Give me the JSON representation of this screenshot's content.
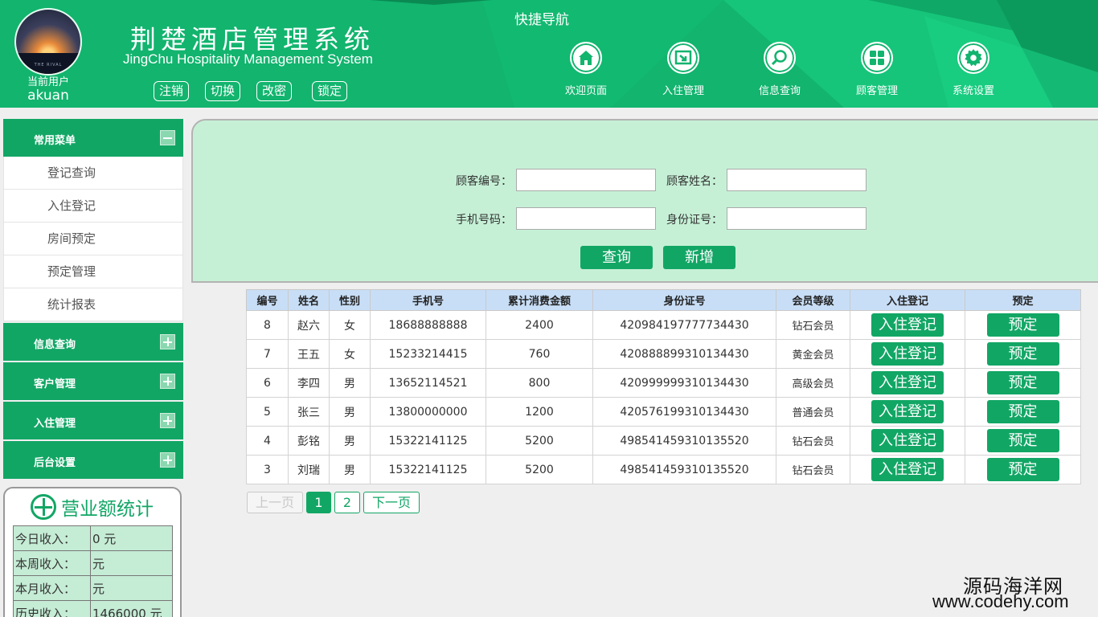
{
  "header": {
    "current_user_label": "当前用户",
    "username": "akuan",
    "avatar_caption": "THE RIVAL",
    "title_cn": "荆楚酒店管理系统",
    "title_en": "JingChu Hospitality Management System",
    "buttons": [
      "注销",
      "切换",
      "改密",
      "锁定"
    ],
    "quick_nav_title": "快捷导航",
    "nav": [
      {
        "label": "欢迎页面",
        "icon": "home-icon"
      },
      {
        "label": "入住管理",
        "icon": "checkin-icon"
      },
      {
        "label": "信息查询",
        "icon": "search-icon"
      },
      {
        "label": "顾客管理",
        "icon": "grid-icon"
      },
      {
        "label": "系统设置",
        "icon": "gear-icon"
      }
    ],
    "colors": {
      "primary": "#12b46e",
      "dark": "#0c9a5c"
    }
  },
  "sidebar": {
    "common_menu": {
      "title": "常用菜单",
      "items": [
        "登记查询",
        "入住登记",
        "房间预定",
        "预定管理",
        "统计报表"
      ]
    },
    "groups": [
      "信息查询",
      "客户管理",
      "入住管理",
      "后台设置"
    ]
  },
  "revenue": {
    "title": "营业额统计",
    "rows": [
      {
        "label": "今日收入：",
        "value": "0 元"
      },
      {
        "label": "本周收入：",
        "value": "元"
      },
      {
        "label": "本月收入：",
        "value": "元"
      },
      {
        "label": "历史收入：",
        "value": "1466000 元"
      }
    ]
  },
  "search": {
    "customer_id_label": "顾客编号：",
    "customer_name_label": "顾客姓名：",
    "phone_label": "手机号码：",
    "id_card_label": "身份证号：",
    "customer_id_value": "",
    "customer_name_value": "",
    "phone_value": "",
    "id_card_value": "",
    "query_button": "查询",
    "add_button": "新增"
  },
  "table": {
    "headers": [
      "编号",
      "姓名",
      "性别",
      "手机号",
      "累计消费金额",
      "身份证号",
      "会员等级",
      "入住登记",
      "预定"
    ],
    "checkin_button": "入住登记",
    "reserve_button": "预定",
    "rows": [
      {
        "id": "8",
        "name": "赵六",
        "gender": "女",
        "phone": "18688888888",
        "spend": "2400",
        "idcard": "420984197777734430",
        "level": "钻石会员"
      },
      {
        "id": "7",
        "name": "王五",
        "gender": "女",
        "phone": "15233214415",
        "spend": "760",
        "idcard": "420888899310134430",
        "level": "黄金会员"
      },
      {
        "id": "6",
        "name": "李四",
        "gender": "男",
        "phone": "13652114521",
        "spend": "800",
        "idcard": "420999999310134430",
        "level": "高级会员"
      },
      {
        "id": "5",
        "name": "张三",
        "gender": "男",
        "phone": "13800000000",
        "spend": "1200",
        "idcard": "420576199310134430",
        "level": "普通会员"
      },
      {
        "id": "4",
        "name": "彭铭",
        "gender": "男",
        "phone": "15322141125",
        "spend": "5200",
        "idcard": "498541459310135520",
        "level": "钻石会员"
      },
      {
        "id": "3",
        "name": "刘瑞",
        "gender": "男",
        "phone": "15322141125",
        "spend": "5200",
        "idcard": "498541459310135520",
        "level": "钻石会员"
      }
    ]
  },
  "pagination": {
    "prev": "上一页",
    "pages": [
      "1",
      "2"
    ],
    "current": "1",
    "next": "下一页"
  },
  "watermark": {
    "line1": "源码海洋网",
    "line2": "www.codehy.com"
  }
}
